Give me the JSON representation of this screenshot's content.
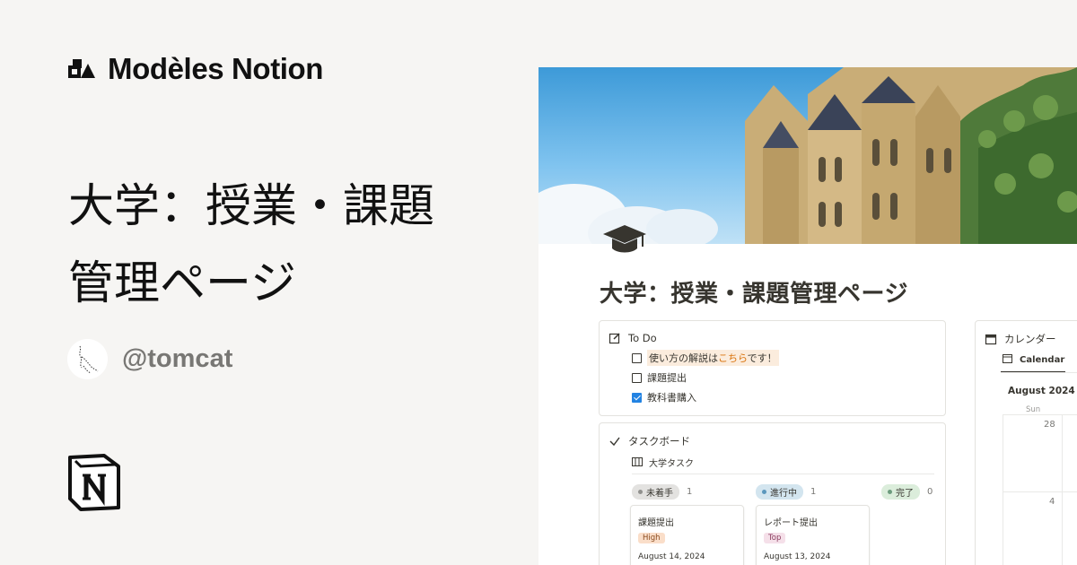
{
  "brand": {
    "name": "Modèles Notion"
  },
  "hero": {
    "title_line1": "大学：授業・課題",
    "title_line2": "管理ページ"
  },
  "author": {
    "handle": "@tomcat"
  },
  "preview": {
    "page_title": "大学：授業・課題管理ページ",
    "todo": {
      "heading": "To Do",
      "items": [
        {
          "text_before": "使い方の解説は",
          "text_link": "こちら",
          "text_after": "です！",
          "checked": false
        },
        {
          "text": "課題提出",
          "checked": false
        },
        {
          "text": "教科書購入",
          "checked": true
        }
      ]
    },
    "taskboard": {
      "heading": "タスクボード",
      "view_name": "大学タスク",
      "columns": [
        {
          "label": "未着手",
          "count": "1",
          "color": "#e3e2e0",
          "dot": "#91918e"
        },
        {
          "label": "進行中",
          "count": "1",
          "color": "#d3e5ef",
          "dot": "#5b97bd"
        },
        {
          "label": "完了",
          "count": "0",
          "color": "#dbeddb",
          "dot": "#6c9b7d"
        }
      ],
      "cards": [
        {
          "title": "課題提出",
          "tag": "High",
          "tag_bg": "#fadec9",
          "tag_fg": "#8a4b1e",
          "date": "August 14, 2024"
        },
        {
          "title": "レポート提出",
          "tag": "Top",
          "tag_bg": "#f5e0e9",
          "tag_fg": "#8a3c5e",
          "date": "August 13, 2024"
        }
      ]
    },
    "calendar": {
      "heading": "カレンダー",
      "view_name": "Calendar",
      "month": "August 2024",
      "dow": "Sun",
      "days": [
        "28",
        "4"
      ]
    }
  }
}
